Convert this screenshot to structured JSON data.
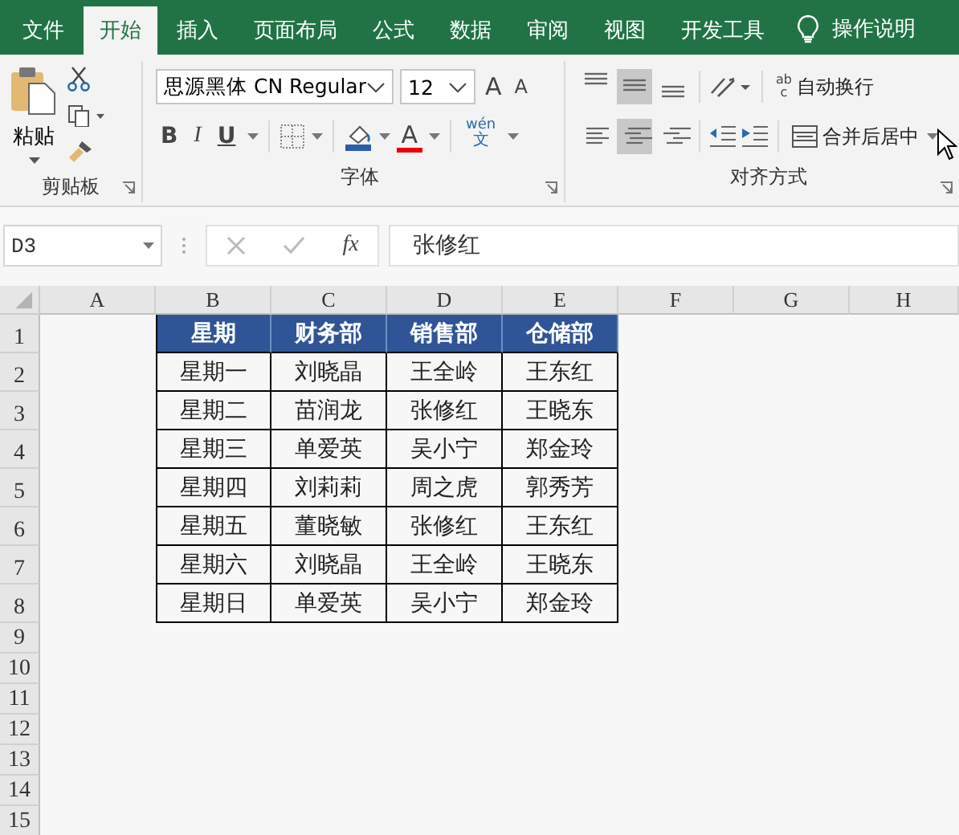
{
  "tabs": [
    {
      "label": "文件",
      "selected": false
    },
    {
      "label": "开始",
      "selected": true
    },
    {
      "label": "插入",
      "selected": false
    },
    {
      "label": "页面布局",
      "selected": false
    },
    {
      "label": "公式",
      "selected": false
    },
    {
      "label": "数据",
      "selected": false
    },
    {
      "label": "审阅",
      "selected": false
    },
    {
      "label": "视图",
      "selected": false
    },
    {
      "label": "开发工具",
      "selected": false
    }
  ],
  "tell_me": {
    "placeholder": "操作说明"
  },
  "ribbon": {
    "clipboard": {
      "paste": "粘贴",
      "label": "剪贴板"
    },
    "font": {
      "family": "思源黑体 CN Regular",
      "size": "12",
      "grow": "A",
      "shrink": "A",
      "bold": "B",
      "italic": "I",
      "underline": "U",
      "font_color": "A",
      "phonetic_top": "wén",
      "phonetic_bottom": "文",
      "label": "字体"
    },
    "alignment": {
      "vertical": [
        {
          "selected": false
        },
        {
          "selected": true
        },
        {
          "selected": false
        }
      ],
      "horizontal": [
        {
          "selected": false
        },
        {
          "selected": true
        },
        {
          "selected": false
        }
      ],
      "wrap_icon_top": "ab",
      "wrap_icon_bottom": "c",
      "wrap": "自动换行",
      "merge": "合并后居中",
      "label": "对齐方式"
    }
  },
  "formula_bar": {
    "name_box": "D3",
    "fx": "fx",
    "value": "张修红"
  },
  "sheet": {
    "columns": [
      "A",
      "B",
      "C",
      "D",
      "E",
      "F",
      "G",
      "H"
    ],
    "rows": [
      "1",
      "2",
      "3",
      "4",
      "5",
      "6",
      "7",
      "8",
      "9",
      "10",
      "11",
      "12",
      "13",
      "14",
      "15"
    ],
    "table": {
      "header": [
        "星期",
        "财务部",
        "销售部",
        "仓储部"
      ],
      "rows": [
        [
          "星期一",
          "刘晓晶",
          "王全岭",
          "王东红"
        ],
        [
          "星期二",
          "苗润龙",
          "张修红",
          "王晓东"
        ],
        [
          "星期三",
          "单爱英",
          "吴小宁",
          "郑金玲"
        ],
        [
          "星期四",
          "刘莉莉",
          "周之虎",
          "郭秀芳"
        ],
        [
          "星期五",
          "董晓敏",
          "张修红",
          "王东红"
        ],
        [
          "星期六",
          "刘晓晶",
          "王全岭",
          "王晓东"
        ],
        [
          "星期日",
          "单爱英",
          "吴小宁",
          "郑金玲"
        ]
      ]
    }
  }
}
